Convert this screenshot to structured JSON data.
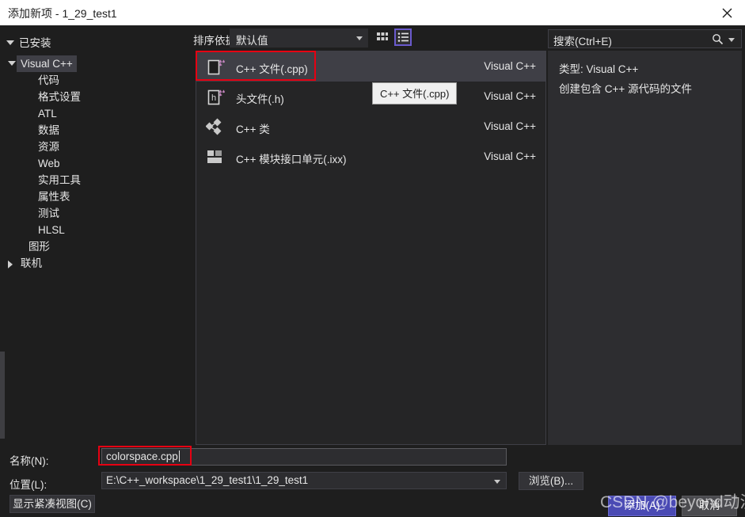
{
  "window": {
    "title": "添加新项 - 1_29_test1",
    "close_icon": "close-icon"
  },
  "left_panel": {
    "installed_header": "已安装",
    "tree": [
      {
        "label": "Visual C++",
        "level": 0,
        "state": "expanded",
        "selected": true
      },
      {
        "label": "代码",
        "level": 1,
        "state": "leaf",
        "selected": false
      },
      {
        "label": "格式设置",
        "level": 1,
        "state": "leaf",
        "selected": false
      },
      {
        "label": "ATL",
        "level": 1,
        "state": "leaf",
        "selected": false
      },
      {
        "label": "数据",
        "level": 1,
        "state": "leaf",
        "selected": false
      },
      {
        "label": "资源",
        "level": 1,
        "state": "leaf",
        "selected": false
      },
      {
        "label": "Web",
        "level": 1,
        "state": "leaf",
        "selected": false
      },
      {
        "label": "实用工具",
        "level": 1,
        "state": "leaf",
        "selected": false
      },
      {
        "label": "属性表",
        "level": 1,
        "state": "leaf",
        "selected": false
      },
      {
        "label": "测试",
        "level": 1,
        "state": "leaf",
        "selected": false
      },
      {
        "label": "HLSL",
        "level": 1,
        "state": "leaf",
        "selected": false
      },
      {
        "label": "图形",
        "level": 0.5,
        "state": "leaf",
        "selected": false
      },
      {
        "label": "联机",
        "level": 0,
        "state": "collapsed",
        "selected": false
      }
    ]
  },
  "center_panel": {
    "sort_label": "排序依据:",
    "sort_value": "默认值",
    "view_grid_icon": "grid-view-icon",
    "view_list_icon": "list-view-icon",
    "items": [
      {
        "name": "C++ 文件(.cpp)",
        "origin": "Visual C++",
        "icon": "cpp-file-icon",
        "selected": true
      },
      {
        "name": "头文件(.h)",
        "origin": "Visual C++",
        "icon": "header-file-icon",
        "selected": false
      },
      {
        "name": "C++ 类",
        "origin": "Visual C++",
        "icon": "cpp-class-icon",
        "selected": false
      },
      {
        "name": "C++ 模块接口单元(.ixx)",
        "origin": "Visual C++",
        "icon": "cpp-module-icon",
        "selected": false
      }
    ],
    "tooltip": "C++ 文件(.cpp)"
  },
  "right_panel": {
    "search_placeholder": "搜索(Ctrl+E)",
    "search_icon": "search-icon",
    "detail_type": "类型: Visual C++",
    "detail_description": "创建包含 C++ 源代码的文件"
  },
  "bottom": {
    "name_label": "名称(N):",
    "name_value": "colorspace.cpp",
    "location_label": "位置(L):",
    "location_value": "E:\\C++_workspace\\1_29_test1\\1_29_test1",
    "compact_view_button": "显示紧凑视图(C)",
    "browse_button": "浏览(B)...",
    "add_button": "添加(A)",
    "cancel_button": "取消"
  },
  "watermark": "CSDN @beyond动漫语",
  "colors": {
    "accent_selection": "#3f3f46",
    "annotation_red": "#e60012",
    "primary_button": "#4a4ab4",
    "view_toggle_border": "#6a5acd",
    "icon_plus_purple": "#c586c0"
  }
}
